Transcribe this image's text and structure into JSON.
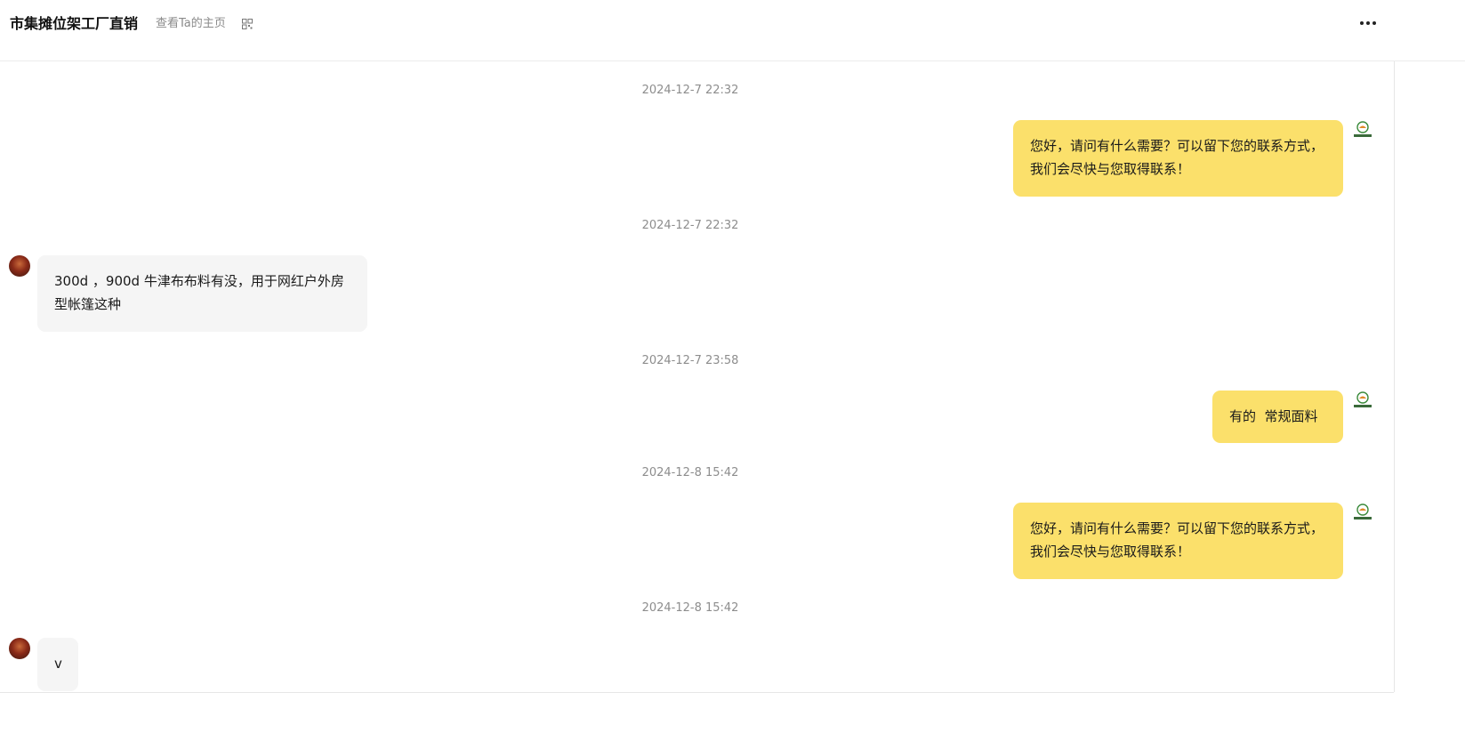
{
  "header": {
    "shop_name": "市集摊位架工厂直销",
    "homepage_link": "查看Ta的主页",
    "qr_icon": "qr-code-icon",
    "more_icon": "more-horizontal-icon"
  },
  "messages": [
    {
      "timestamp": "2024-12-7 22:32",
      "sender": "me",
      "text": "您好，请问有什么需要？可以留下您的联系方式，我们会尽快与您取得联系！"
    },
    {
      "timestamp": "2024-12-7 22:32",
      "sender": "them",
      "text": "300d ，900d 牛津布布料有没，用于网红户外房型帐篷这种"
    },
    {
      "timestamp": "2024-12-7 23:58",
      "sender": "me",
      "text": "有的  常规面料"
    },
    {
      "timestamp": "2024-12-8 15:42",
      "sender": "me",
      "text": "您好，请问有什么需要？可以留下您的联系方式，我们会尽快与您取得联系！"
    },
    {
      "timestamp": "2024-12-8 15:42",
      "sender": "them",
      "text": "v"
    }
  ],
  "colors": {
    "my_bubble": "#fbe06b",
    "their_bubble": "#f5f5f5",
    "timestamp": "#8d8d8d"
  }
}
